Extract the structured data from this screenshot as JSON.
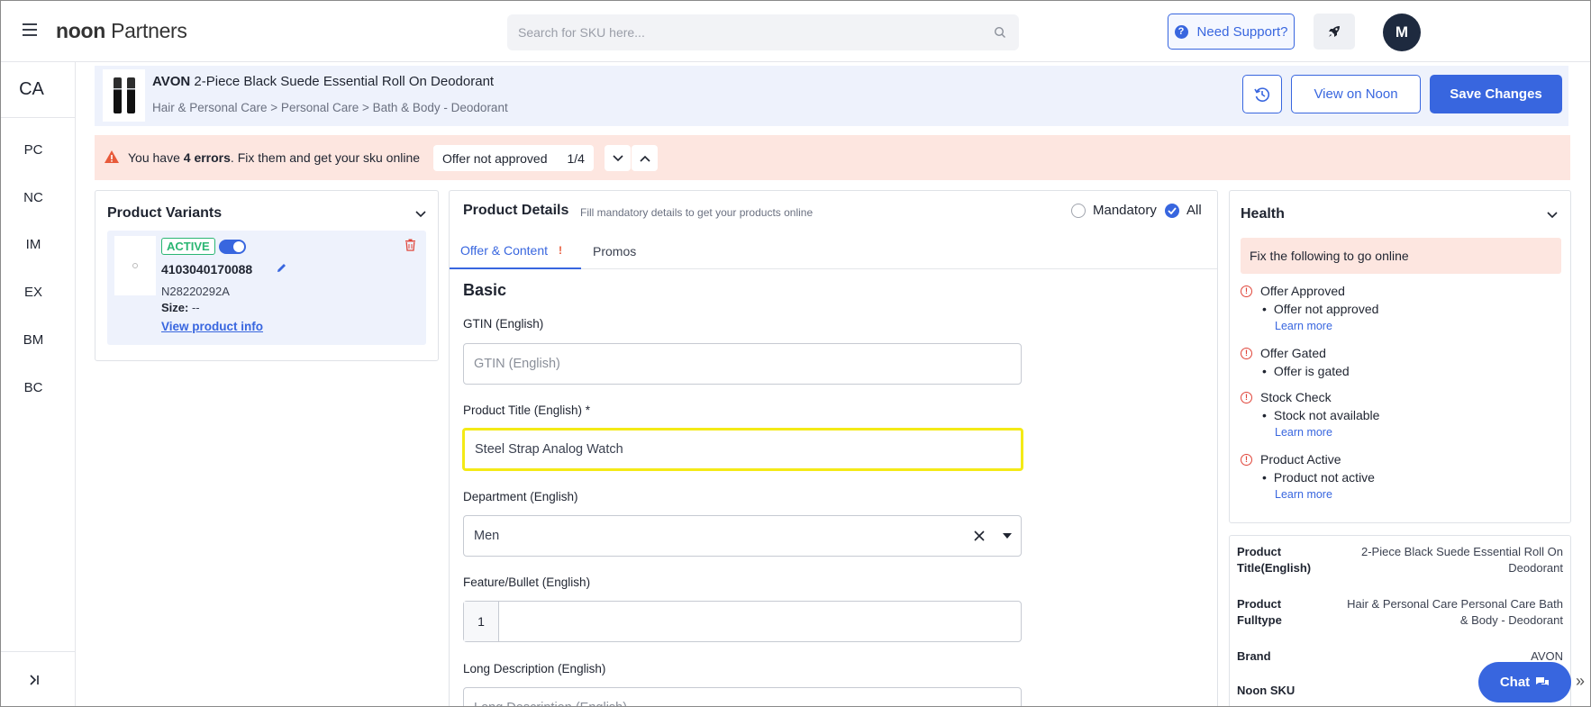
{
  "topbar": {
    "logo_bold": "noon",
    "logo_rest": " Partners",
    "search_placeholder": "Search for SKU here...",
    "support_label": "Need Support?",
    "support_icon": "?",
    "avatar_initial": "M"
  },
  "rail": {
    "top": "CA",
    "items": [
      "PC",
      "NC",
      "IM",
      "EX",
      "BM",
      "BC"
    ]
  },
  "product": {
    "brand": "AVON",
    "title": " 2-Piece Black Suede Essential Roll On Deodorant",
    "breadcrumb": "Hair & Personal Care > Personal Care > Bath & Body - Deodorant",
    "view_label": "View on Noon",
    "save_label": "Save Changes"
  },
  "errors": {
    "prefix": "You have ",
    "count_text": "4 errors",
    "suffix": ". Fix them and get your sku online",
    "offer_label": "Offer not approved",
    "pager": "1/4"
  },
  "variants": {
    "title": "Product Variants",
    "status": "ACTIVE",
    "sku": "4103040170088",
    "code": "N28220292A",
    "size_label": "Size:",
    "size_value": "--",
    "link_label": "View product info"
  },
  "details": {
    "title": "Product Details",
    "subtitle": "Fill mandatory details to get your products online",
    "filter_mandatory": "Mandatory",
    "filter_all": "All",
    "tabs": [
      "Offer & Content",
      "Promos"
    ],
    "tab_warning": "!",
    "section": "Basic",
    "gtin_label": "GTIN (English)",
    "gtin_placeholder": "GTIN (English)",
    "title_label": "Product Title (English) *",
    "title_value": "Steel Strap Analog Watch",
    "dept_label": "Department (English)",
    "dept_value": "Men",
    "bullet_label": "Feature/Bullet (English)",
    "bullet_num": "1",
    "long_label": "Long Description (English)",
    "long_placeholder": "Long Description (English)"
  },
  "health": {
    "title": "Health",
    "banner": "Fix the following to go online",
    "learn_more": "Learn more",
    "items": [
      {
        "head": "Offer Approved",
        "detail": "Offer not approved"
      },
      {
        "head": "Offer Gated",
        "detail": "Offer is gated"
      },
      {
        "head": "Stock Check",
        "detail": "Stock not available"
      },
      {
        "head": "Product Active",
        "detail": "Product not active"
      }
    ]
  },
  "info": {
    "rows": [
      {
        "key": "Product Title(English)",
        "value": "2-Piece Black Suede Essential Roll On Deodorant"
      },
      {
        "key": "Product Fulltype",
        "value": "Hair & Personal Care Personal Care Bath & Body - Deodorant"
      },
      {
        "key": "Brand",
        "value": "AVON"
      },
      {
        "key": "Noon SKU",
        "value": ""
      }
    ]
  },
  "chat": {
    "label": "Chat",
    "collapse": "»"
  },
  "colors": {
    "accent": "#3866df",
    "error_bg": "#fde6e0",
    "highlight": "#f4ea16",
    "active_green": "#2bb673"
  }
}
